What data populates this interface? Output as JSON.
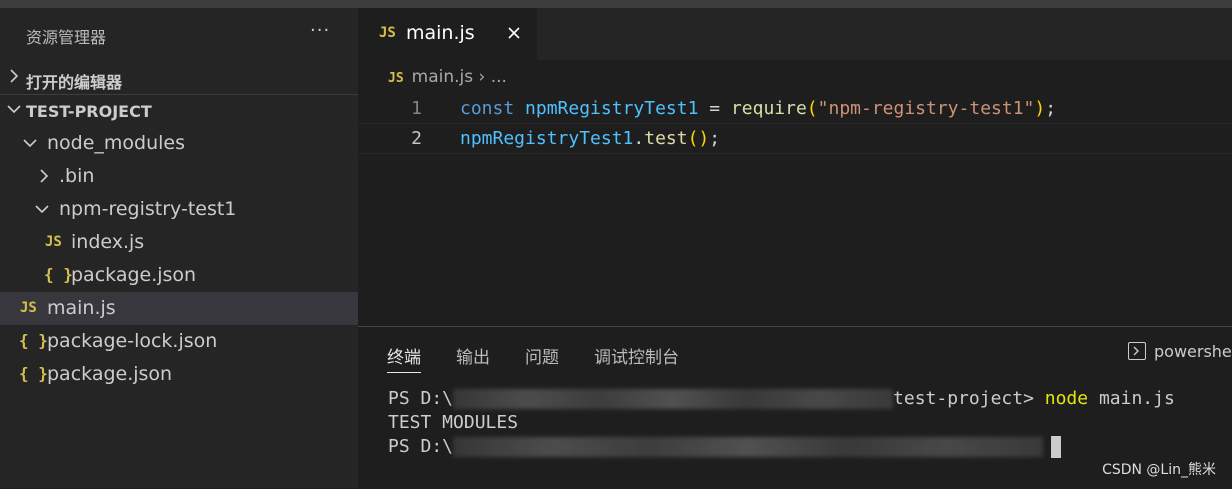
{
  "sidebar": {
    "title": "资源管理器",
    "more_icon": "ellipsis-icon",
    "open_editors_label": "打开的编辑器",
    "project_label": "TEST-PROJECT",
    "tree": [
      {
        "label": "node_modules",
        "kind": "folder",
        "expanded": true
      },
      {
        "label": ".bin",
        "kind": "folder",
        "expanded": false
      },
      {
        "label": "npm-registry-test1",
        "kind": "folder",
        "expanded": true
      },
      {
        "label": "index.js",
        "kind": "js",
        "icon_text": "JS"
      },
      {
        "label": "package.json",
        "kind": "json",
        "icon_text": "{ }"
      },
      {
        "label": "main.js",
        "kind": "js",
        "icon_text": "JS",
        "selected": true
      },
      {
        "label": "package-lock.json",
        "kind": "json",
        "icon_text": "{ }"
      },
      {
        "label": "package.json",
        "kind": "json",
        "icon_text": "{ }"
      }
    ]
  },
  "editor": {
    "tab": {
      "icon_text": "JS",
      "label": "main.js"
    },
    "breadcrumb": {
      "icon_text": "JS",
      "file": "main.js",
      "sep": "›",
      "rest": "..."
    },
    "lines": [
      {
        "number": "1",
        "const": "const",
        "var": "npmRegistryTest1",
        "eq": " = ",
        "fn": "require",
        "open": "(",
        "str": "\"npm-registry-test1\"",
        "close": ")",
        "end": ";"
      },
      {
        "number": "2",
        "var": "npmRegistryTest1",
        "dot": ".",
        "fn": "test",
        "parens": "()",
        "end": ";"
      }
    ]
  },
  "panel": {
    "tabs": [
      "终端",
      "输出",
      "问题",
      "调试控制台"
    ],
    "active_tab": "终端",
    "shell_label": "powershel",
    "terminal": {
      "line1_prefix": "PS D:\\",
      "line1_suffix": "test-project> ",
      "line1_cmd": "node",
      "line1_args": " main.js",
      "line2": "TEST MODULES",
      "line3_prefix": "PS D:\\"
    }
  },
  "watermark": "CSDN @Lin_熊米",
  "colors": {
    "accent_js": "#d4c04a",
    "keyword": "#569cd6",
    "variable": "#4fc1ff",
    "function": "#dcdcaa",
    "string": "#ce9178",
    "bracket": "#ffd700"
  }
}
